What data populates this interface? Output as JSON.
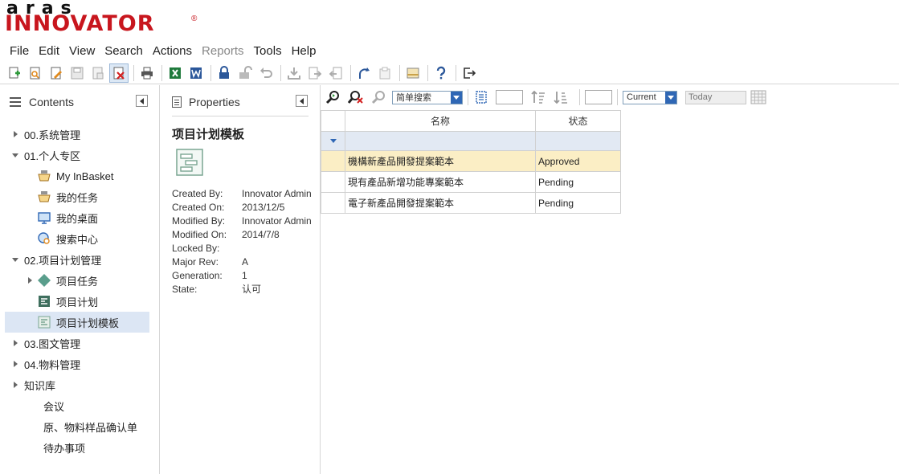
{
  "logo": {
    "line1": "aras",
    "line2": "INNOVATOR",
    "reg": "®"
  },
  "menu": [
    {
      "label": "File",
      "enabled": true
    },
    {
      "label": "Edit",
      "enabled": true
    },
    {
      "label": "View",
      "enabled": true
    },
    {
      "label": "Search",
      "enabled": true
    },
    {
      "label": "Actions",
      "enabled": true
    },
    {
      "label": "Reports",
      "enabled": false
    },
    {
      "label": "Tools",
      "enabled": true
    },
    {
      "label": "Help",
      "enabled": true
    }
  ],
  "contents": {
    "title": "Contents",
    "tree": [
      {
        "label": "00.系统管理",
        "state": "collapsed"
      },
      {
        "label": "01.个人专区",
        "state": "expanded"
      },
      {
        "label": "My InBasket",
        "icon": "inbasket-icon"
      },
      {
        "label": "我的任务",
        "icon": "inbasket-icon"
      },
      {
        "label": "我的桌面",
        "icon": "desktop-icon"
      },
      {
        "label": "搜索中心",
        "icon": "search-center-icon"
      },
      {
        "label": "02.项目计划管理",
        "state": "expanded"
      },
      {
        "label": "项目任务",
        "icon": "diamond-icon",
        "state": "collapsed"
      },
      {
        "label": "项目计划",
        "icon": "plan-icon"
      },
      {
        "label": "项目计划模板",
        "icon": "template-icon",
        "selected": true
      },
      {
        "label": "03.图文管理",
        "state": "collapsed"
      },
      {
        "label": "04.物料管理",
        "state": "collapsed"
      },
      {
        "label": "知识库",
        "state": "collapsed"
      },
      {
        "label": "会议"
      },
      {
        "label": "原、物料样品确认单"
      },
      {
        "label": "待办事项"
      }
    ]
  },
  "properties": {
    "title": "Properties",
    "item_title": "项目计划模板",
    "fields": [
      {
        "label": "Created By:",
        "value": "Innovator Admin"
      },
      {
        "label": "Created On:",
        "value": "2013/12/5"
      },
      {
        "label": "Modified By:",
        "value": "Innovator Admin"
      },
      {
        "label": "Modified On:",
        "value": "2014/7/8"
      },
      {
        "label": "Locked By:",
        "value": ""
      },
      {
        "label": "Major Rev:",
        "value": "A"
      },
      {
        "label": "Generation:",
        "value": "1"
      },
      {
        "label": "State:",
        "value": "认可"
      }
    ]
  },
  "grid_toolbar": {
    "search_mode": "简单搜索",
    "version": "Current",
    "date_placeholder": "Today"
  },
  "grid": {
    "columns": [
      "名称",
      "状态"
    ],
    "rows": [
      {
        "name": "機構新產品開發提案範本",
        "status": "Approved",
        "selected": true
      },
      {
        "name": "現有產品新增功能專案範本",
        "status": "Pending",
        "selected": false
      },
      {
        "name": "電子新產品開發提案範本",
        "status": "Pending",
        "selected": false
      }
    ]
  },
  "colors": {
    "brand_red": "#c8161e",
    "selection_blue": "#dce6f4",
    "row_highlight": "#fbeec5",
    "accent_blue": "#2f67b5"
  }
}
